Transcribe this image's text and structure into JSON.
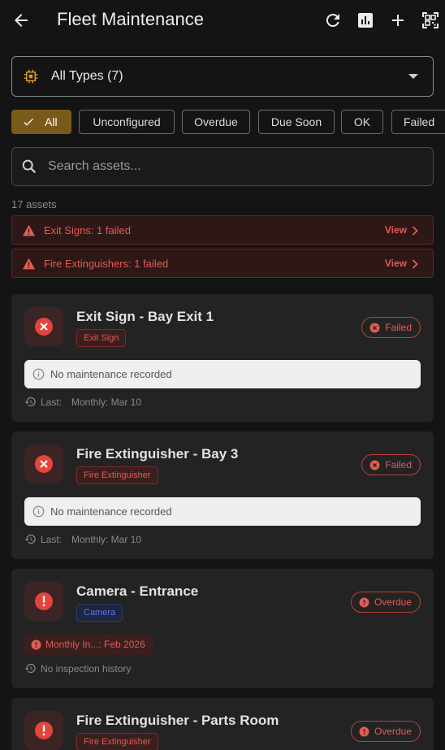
{
  "appbar": {
    "title": "Fleet Maintenance",
    "back_icon": "arrow-left-icon",
    "actions": [
      "refresh-icon",
      "chart-icon",
      "plus-icon",
      "qr-scan-icon"
    ]
  },
  "type_filter": {
    "label": "All Types (7)",
    "icon": "chip-icon"
  },
  "filters": [
    "All",
    "Unconfigured",
    "Overdue",
    "Due Soon",
    "OK",
    "Failed"
  ],
  "search": {
    "placeholder": "Search assets..."
  },
  "asset_count": "17 assets",
  "alerts": [
    {
      "text": "Exit Signs: 1 failed",
      "action": "View"
    },
    {
      "text": "Fire Extinguishers: 1 failed",
      "action": "View"
    }
  ],
  "cards": [
    {
      "name": "Exit Sign - Bay Exit 1",
      "tag": "Exit Sign",
      "status": "Failed",
      "maintenance": "No maintenance recorded",
      "history_label": "Last:",
      "history_value": "Monthly: Mar 10"
    },
    {
      "name": "Fire Extinguisher - Bay 3",
      "tag": "Fire Extinguisher",
      "status": "Failed",
      "maintenance": "No maintenance recorded",
      "history_label": "Last:",
      "history_value": "Monthly: Mar 10"
    },
    {
      "name": "Camera - Entrance",
      "tag": "Camera",
      "status": "Overdue",
      "due": "Monthly In...: Feb 2026",
      "history_value": "No inspection history"
    },
    {
      "name": "Fire Extinguisher - Parts Room",
      "tag": "Fire Extinguisher",
      "status": "Overdue"
    }
  ],
  "colors": {
    "accent": "#7a5a1b",
    "danger": "#e25c54",
    "background": "#141414",
    "card": "#232323"
  }
}
